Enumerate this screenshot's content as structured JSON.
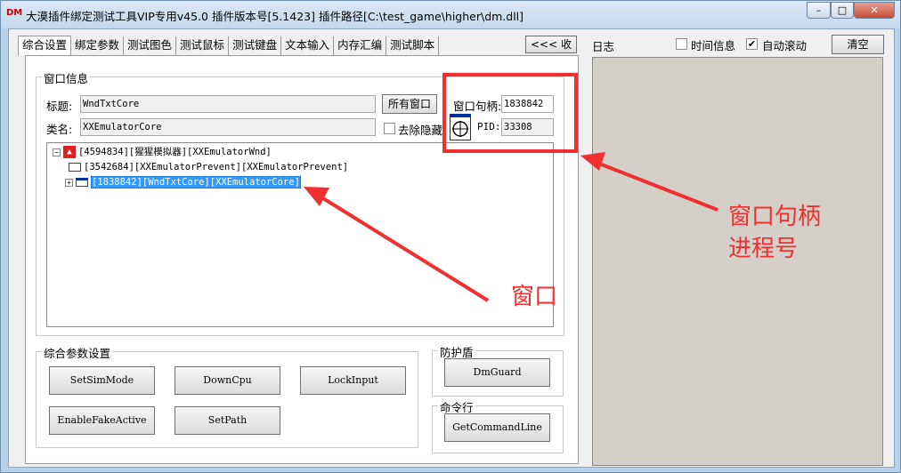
{
  "titlebar": {
    "icon_text": "DM",
    "title": "大漠插件绑定测试工具VIP专用v45.0 插件版本号[5.1423] 插件路径[C:\\test_game\\higher\\dm.dll]",
    "minimize": "–",
    "maximize": "□",
    "close": "✕"
  },
  "tabs": [
    "综合设置",
    "绑定参数",
    "测试图色",
    "测试鼠标",
    "测试键盘",
    "文本输入",
    "内存汇编",
    "测试脚本"
  ],
  "collapse_label": "<<< 收起",
  "window_info": {
    "group_title": "窗口信息",
    "title_label": "标题:",
    "title_value": "WndTxtCore",
    "class_label": "类名:",
    "class_value": "XXEmulatorCore",
    "all_windows_button": "所有窗口",
    "remove_hidden_label": "去除隐藏",
    "handle_label": "窗口句柄:",
    "handle_value": "1838842",
    "pid_label": "PID:",
    "pid_value": "33308"
  },
  "tree": [
    {
      "expander": "−",
      "text": "[4594834][猩猩模拟器][XXEmulatorWnd]"
    },
    {
      "expander": "",
      "text": "[3542684][XXEmulatorPrevent][XXEmulatorPrevent]"
    },
    {
      "expander": "+",
      "text": "[1838842][WndTxtCore][XXEmulatorCore]"
    }
  ],
  "params": {
    "group_title": "综合参数设置",
    "buttons": [
      "SetSimMode",
      "DownCpu",
      "LockInput",
      "EnableFakeActive",
      "SetPath"
    ]
  },
  "guard": {
    "group_title": "防护盾",
    "button": "DmGuard"
  },
  "cmdline": {
    "group_title": "命令行",
    "button": "GetCommandLine"
  },
  "log": {
    "label": "日志",
    "time_info_label": "时间信息",
    "time_info_checked": false,
    "auto_scroll_label": "自动滚动",
    "auto_scroll_checked": true,
    "clear_button": "清空"
  },
  "annotations": {
    "handle_pid_line1": "窗口句柄",
    "handle_pid_line2": "进程号",
    "window": "窗口",
    "color": "#f03030"
  }
}
